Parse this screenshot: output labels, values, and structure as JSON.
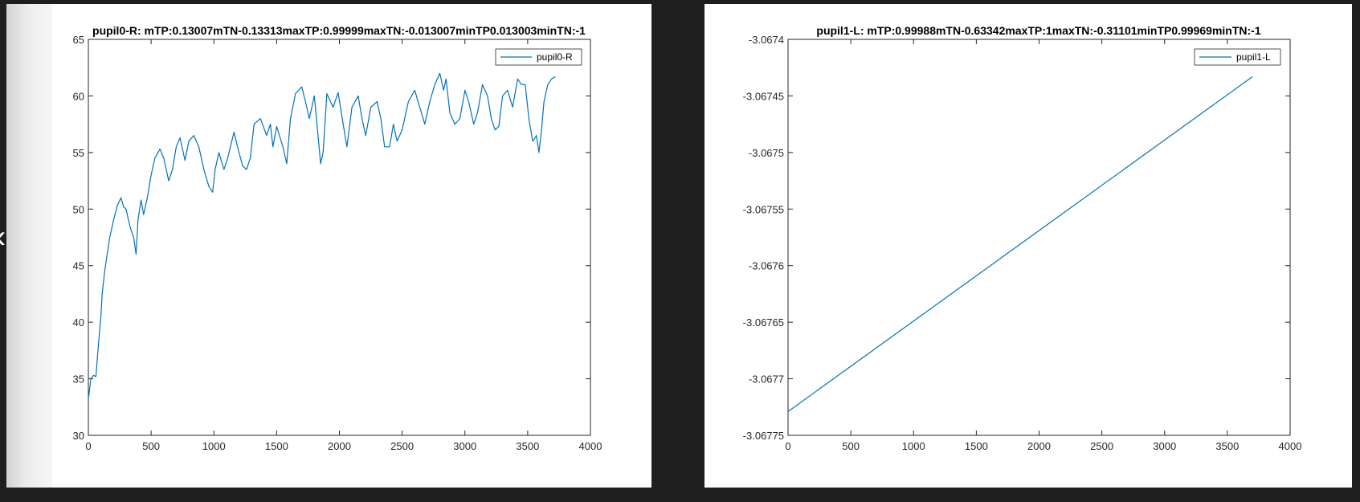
{
  "colors": {
    "series": "#0072BD",
    "background": "#1e1e1e",
    "axes": "#262626"
  },
  "icons": {
    "nav": "chevron-left-icon"
  },
  "chart_data": [
    {
      "type": "line",
      "title": "pupil0-R: mTP:0.13007mTN-0.13313maxTP:0.99999maxTN:-0.013007minTP0.013003minTN:-1",
      "xlim": [
        0,
        4000
      ],
      "ylim": [
        30,
        65
      ],
      "xticks": [
        0,
        500,
        1000,
        1500,
        2000,
        2500,
        3000,
        3500,
        4000
      ],
      "yticks": [
        30,
        35,
        40,
        45,
        50,
        55,
        60,
        65
      ],
      "xtick_labels": [
        "0",
        "500",
        "1000",
        "1500",
        "2000",
        "2500",
        "3000",
        "3500",
        "4000"
      ],
      "ytick_labels": [
        "30",
        "35",
        "40",
        "45",
        "50",
        "55",
        "60",
        "65"
      ],
      "legend_placement": "top-right",
      "grid": false,
      "series": [
        {
          "name": "pupil0-R",
          "x": [
            0,
            20,
            40,
            60,
            80,
            100,
            110,
            130,
            150,
            170,
            200,
            230,
            260,
            280,
            300,
            330,
            360,
            380,
            395,
            420,
            440,
            470,
            500,
            530,
            570,
            600,
            640,
            670,
            700,
            730,
            770,
            800,
            840,
            880,
            920,
            960,
            990,
            1010,
            1040,
            1080,
            1110,
            1160,
            1200,
            1230,
            1260,
            1290,
            1320,
            1370,
            1420,
            1450,
            1470,
            1500,
            1550,
            1580,
            1610,
            1650,
            1700,
            1730,
            1760,
            1800,
            1830,
            1850,
            1870,
            1900,
            1950,
            1990,
            2030,
            2060,
            2100,
            2150,
            2180,
            2210,
            2250,
            2300,
            2330,
            2360,
            2400,
            2430,
            2460,
            2500,
            2550,
            2600,
            2640,
            2680,
            2720,
            2760,
            2800,
            2830,
            2850,
            2880,
            2920,
            2960,
            3000,
            3030,
            3070,
            3100,
            3140,
            3180,
            3210,
            3240,
            3270,
            3300,
            3340,
            3380,
            3420,
            3450,
            3480,
            3510,
            3540,
            3570,
            3590,
            3610,
            3630,
            3660,
            3690,
            3720
          ],
          "values": [
            33.2,
            35.0,
            35.3,
            35.2,
            38.0,
            40.5,
            42.5,
            44.5,
            46.0,
            47.5,
            49.0,
            50.3,
            51.0,
            50.2,
            50.0,
            48.5,
            47.5,
            46.0,
            49.0,
            50.8,
            49.5,
            51.0,
            53.0,
            54.5,
            55.3,
            54.5,
            52.5,
            53.5,
            55.5,
            56.3,
            54.3,
            56.0,
            56.5,
            55.5,
            53.5,
            52.0,
            51.5,
            53.5,
            55.0,
            53.5,
            54.5,
            56.8,
            55.0,
            53.8,
            53.5,
            54.5,
            57.5,
            58.0,
            56.5,
            57.5,
            55.5,
            57.3,
            55.5,
            54.0,
            58.0,
            60.2,
            60.8,
            59.5,
            58.0,
            60.0,
            56.5,
            54.0,
            55.0,
            60.2,
            59.0,
            60.3,
            57.5,
            55.5,
            59.0,
            60.0,
            58.0,
            56.5,
            59.0,
            59.5,
            58.0,
            55.5,
            55.5,
            57.5,
            56.0,
            57.0,
            59.5,
            60.5,
            59.0,
            57.5,
            59.5,
            61.0,
            62.0,
            60.5,
            61.5,
            58.5,
            57.5,
            58.0,
            60.5,
            59.5,
            57.5,
            58.5,
            61.0,
            60.0,
            58.0,
            57.0,
            57.3,
            60.0,
            60.5,
            59.0,
            61.5,
            61.0,
            61.0,
            58.0,
            56.0,
            56.5,
            55.0,
            57.0,
            59.5,
            61.0,
            61.5,
            61.7
          ]
        }
      ]
    },
    {
      "type": "line",
      "title": "pupil1-L: mTP:0.99988mTN-0.63342maxTP:1maxTN:-0.31101minTP0.99969minTN:-1",
      "xlim": [
        0,
        4000
      ],
      "ylim": [
        -3.06775,
        -3.0674
      ],
      "xticks": [
        0,
        500,
        1000,
        1500,
        2000,
        2500,
        3000,
        3500,
        4000
      ],
      "yticks": [
        -3.06775,
        -3.0677,
        -3.06765,
        -3.0676,
        -3.06755,
        -3.0675,
        -3.06745,
        -3.0674
      ],
      "xtick_labels": [
        "0",
        "500",
        "1000",
        "1500",
        "2000",
        "2500",
        "3000",
        "3500",
        "4000"
      ],
      "ytick_labels": [
        "-3.06775",
        "-3.0677",
        "-3.06765",
        "-3.0676",
        "-3.06755",
        "-3.0675",
        "-3.06745",
        "-3.0674"
      ],
      "legend_placement": "top-right",
      "grid": false,
      "series": [
        {
          "name": "pupil1-L",
          "x": [
            0,
            3700
          ],
          "values": [
            -3.067729,
            -3.067433
          ]
        }
      ]
    }
  ]
}
